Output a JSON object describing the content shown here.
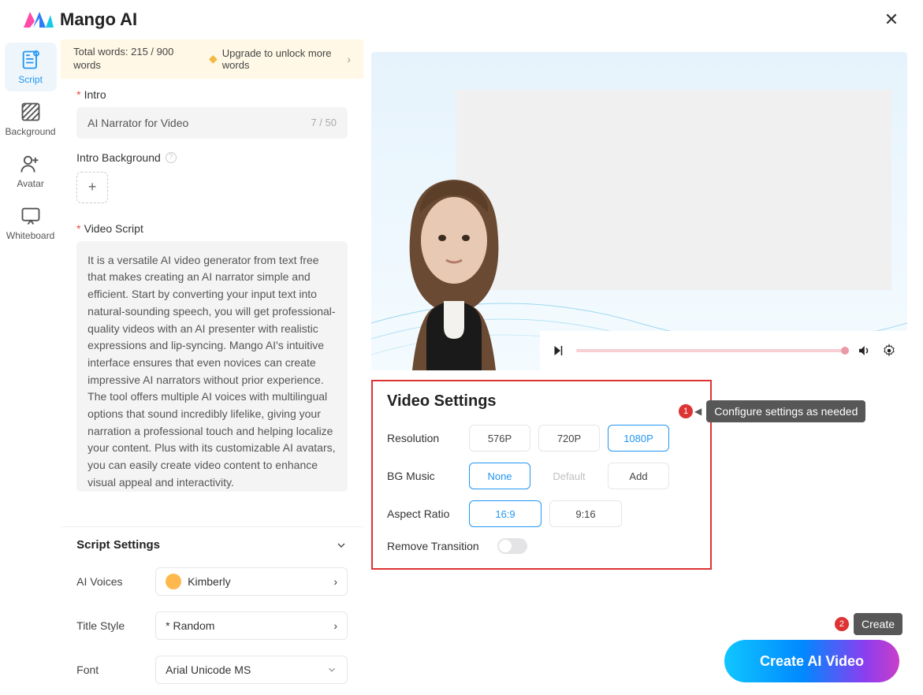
{
  "header": {
    "brand": "Mango AI"
  },
  "sidebar": {
    "items": [
      {
        "label": "Script"
      },
      {
        "label": "Background"
      },
      {
        "label": "Avatar"
      },
      {
        "label": "Whiteboard"
      }
    ]
  },
  "wordsBar": {
    "total": "Total words: 215 / 900 words",
    "upgrade": "Upgrade to unlock more words"
  },
  "intro": {
    "label": "Intro",
    "value": "AI Narrator for Video",
    "count": "7 / 50",
    "bgLabel": "Intro Background"
  },
  "videoScript": {
    "label": "Video Script",
    "text": "It is a versatile AI video generator from text free that makes creating an AI narrator simple and efficient. Start by converting your input text into natural-sounding speech, you will get professional-quality videos with an AI presenter with realistic expressions and lip-syncing. Mango AI's intuitive interface ensures that even novices can create impressive AI narrators without prior experience. The tool offers multiple AI voices with multilingual options that sound incredibly lifelike, giving your narration a professional touch and helping localize your content. Plus with its customizable AI avatars, you can easily create video content to enhance visual appeal and interactivity."
  },
  "scriptSettings": {
    "title": "Script Settings",
    "voices": {
      "label": "AI Voices",
      "value": "Kimberly"
    },
    "titleStyle": {
      "label": "Title Style",
      "value": "* Random"
    },
    "font": {
      "label": "Font",
      "value": "Arial Unicode MS"
    }
  },
  "videoSettings": {
    "title": "Video Settings",
    "resolution": {
      "label": "Resolution",
      "opts": [
        "576P",
        "720P",
        "1080P"
      ],
      "selected": "1080P"
    },
    "bgMusic": {
      "label": "BG Music",
      "opts": [
        "None",
        "Default",
        "Add"
      ],
      "selected": "None",
      "disabled": "Default"
    },
    "aspect": {
      "label": "Aspect Ratio",
      "opts": [
        "16:9",
        "9:16"
      ],
      "selected": "16:9"
    },
    "removeTransition": {
      "label": "Remove Transition"
    }
  },
  "callouts": {
    "c1": {
      "num": "1",
      "text": "Configure settings as needed"
    },
    "c2": {
      "num": "2",
      "text": "Create"
    }
  },
  "createBtn": "Create AI Video"
}
